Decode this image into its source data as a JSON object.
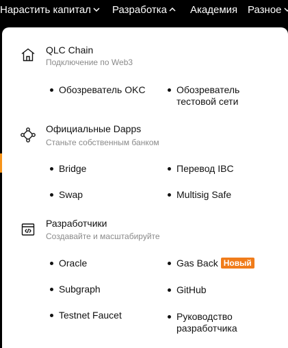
{
  "topnav": {
    "items": [
      {
        "label": "Нарастить капитал",
        "chevron": "down"
      },
      {
        "label": "Разработка",
        "chevron": "up"
      },
      {
        "label": "Академия"
      },
      {
        "label": "Разное",
        "chevron": "down"
      }
    ]
  },
  "dropdown": {
    "sections": [
      {
        "icon": "home-icon",
        "title": "QLC Chain",
        "subtitle": "Подключение по Web3",
        "links": [
          {
            "label": "Обозреватель OKC"
          },
          {
            "label": "Обозреватель тестовой сети"
          }
        ]
      },
      {
        "icon": "network-nodes-icon",
        "title": "Официальные Dapps",
        "subtitle": "Станьте собственным банком",
        "links": [
          {
            "label": "Bridge"
          },
          {
            "label": "Перевод IBC"
          },
          {
            "label": "Swap"
          },
          {
            "label": "Multisig Safe"
          }
        ]
      },
      {
        "icon": "code-window-icon",
        "title": "Разработчики",
        "subtitle": "Создавайте и масштабируйте",
        "links": [
          {
            "label": "Oracle"
          },
          {
            "label": "Gas Back",
            "badge": "Новый"
          },
          {
            "label": "Subgraph"
          },
          {
            "label": "GitHub"
          },
          {
            "label": "Testnet Faucet"
          },
          {
            "label": "Руководство разработчика"
          }
        ]
      }
    ]
  },
  "colors": {
    "accent": "#f07c1a",
    "background": "#000000",
    "panel": "#ffffff",
    "muted_text": "#8a8a8a"
  }
}
